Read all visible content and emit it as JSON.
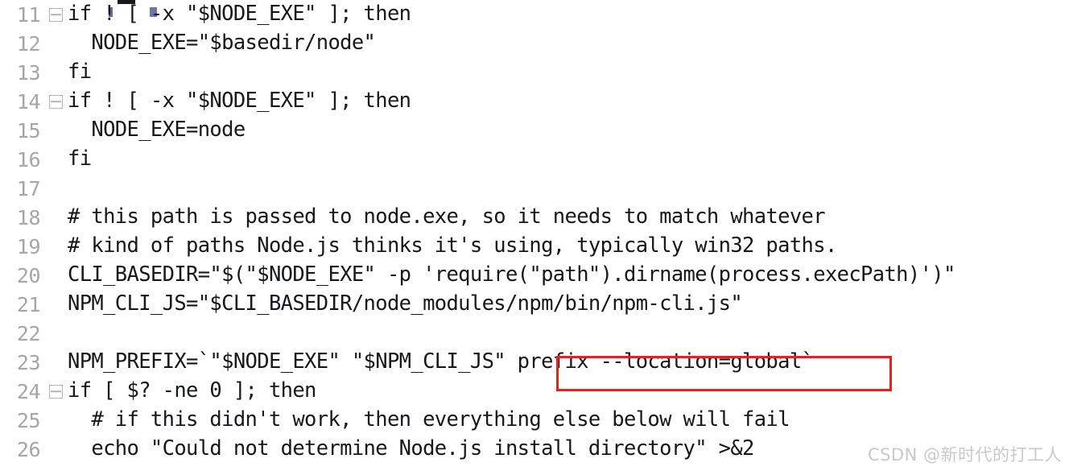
{
  "editor": {
    "kind": "code-editor-snippet",
    "language": "shell",
    "background_color": "#ffffff",
    "code_text_color": "#15181c",
    "line_number_color": "#a6a6a6",
    "fold_marker_color": "#b4b4b4",
    "highlight_color": "#f41b1b",
    "lines": [
      {
        "number": "11",
        "fold": true,
        "text": "if ! [ -x \"$NODE_EXE\" ]; then"
      },
      {
        "number": "12",
        "fold": false,
        "text": "  NODE_EXE=\"$basedir/node\""
      },
      {
        "number": "13",
        "fold": false,
        "text": "fi"
      },
      {
        "number": "14",
        "fold": true,
        "text": "if ! [ -x \"$NODE_EXE\" ]; then"
      },
      {
        "number": "15",
        "fold": false,
        "text": "  NODE_EXE=node"
      },
      {
        "number": "16",
        "fold": false,
        "text": "fi"
      },
      {
        "number": "17",
        "fold": false,
        "text": ""
      },
      {
        "number": "18",
        "fold": false,
        "text": "# this path is passed to node.exe, so it needs to match whatever"
      },
      {
        "number": "19",
        "fold": false,
        "text": "# kind of paths Node.js thinks it's using, typically win32 paths."
      },
      {
        "number": "20",
        "fold": false,
        "text": "CLI_BASEDIR=\"$(\"$NODE_EXE\" -p 'require(\"path\").dirname(process.execPath)')\""
      },
      {
        "number": "21",
        "fold": false,
        "text": "NPM_CLI_JS=\"$CLI_BASEDIR/node_modules/npm/bin/npm-cli.js\""
      },
      {
        "number": "22",
        "fold": false,
        "text": ""
      },
      {
        "number": "23",
        "fold": false,
        "text": "NPM_PREFIX=`\"$NODE_EXE\" \"$NPM_CLI_JS\" prefix --location=global`"
      },
      {
        "number": "24",
        "fold": true,
        "text": "if [ $? -ne 0 ]; then"
      },
      {
        "number": "25",
        "fold": false,
        "text": "  # if this didn't work, then everything else below will fail"
      },
      {
        "number": "26",
        "fold": false,
        "text": "  echo \"Could not determine Node.js install directory\" >&2"
      }
    ],
    "highlight": {
      "line_number": "23",
      "text": "prefix --location=global`"
    }
  },
  "watermark": {
    "text": "CSDN @新时代的打工人"
  }
}
